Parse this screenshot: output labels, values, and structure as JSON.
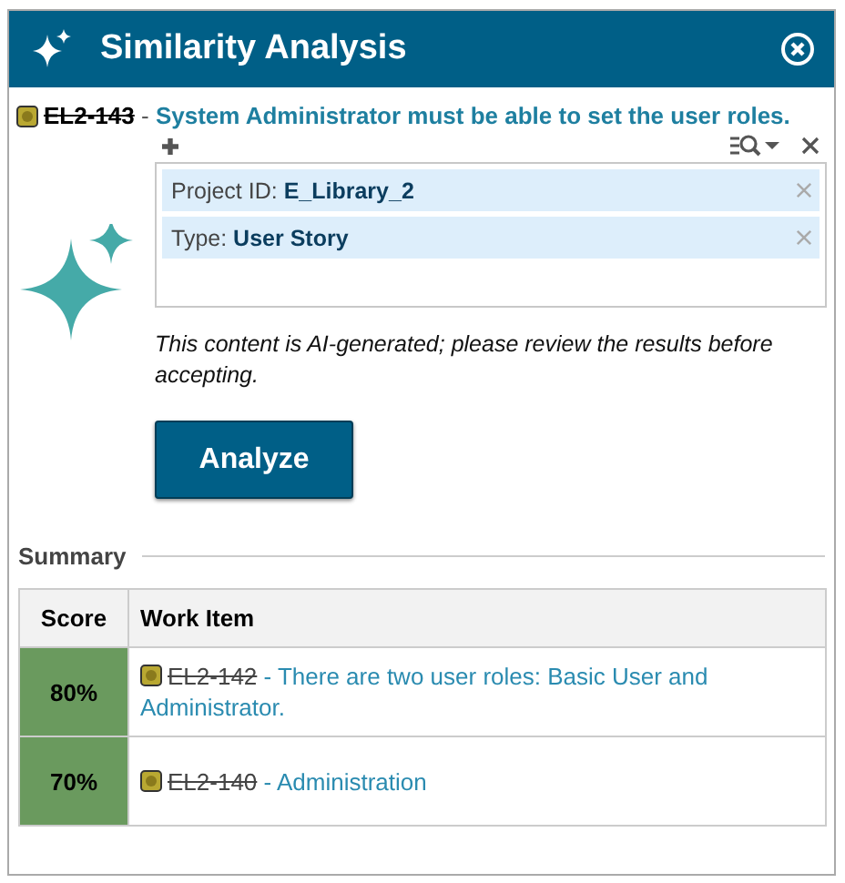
{
  "window": {
    "title": "Similarity Analysis"
  },
  "work_item": {
    "id": "EL2-143",
    "struck": true,
    "separator": " - ",
    "title": "System Administrator must be able to set the user roles."
  },
  "filters": [
    {
      "label": "Project ID: ",
      "value": "E_Library_2"
    },
    {
      "label": "Type: ",
      "value": "User Story"
    }
  ],
  "disclaimer": "This content is AI-generated; please review the results before accepting.",
  "analyze_button": "Analyze",
  "summary": {
    "title": "Summary",
    "columns": [
      "Score",
      "Work Item"
    ],
    "rows": [
      {
        "score": "80%",
        "color": "#6a9a5e",
        "id": "EL2-142",
        "struck": true,
        "separator": " - ",
        "title": "There are two user roles: Basic User and Administrator."
      },
      {
        "score": "70%",
        "color": "#6a9a5e",
        "id": "EL2-140",
        "struck": true,
        "separator": " - ",
        "title": "Administration"
      }
    ]
  }
}
